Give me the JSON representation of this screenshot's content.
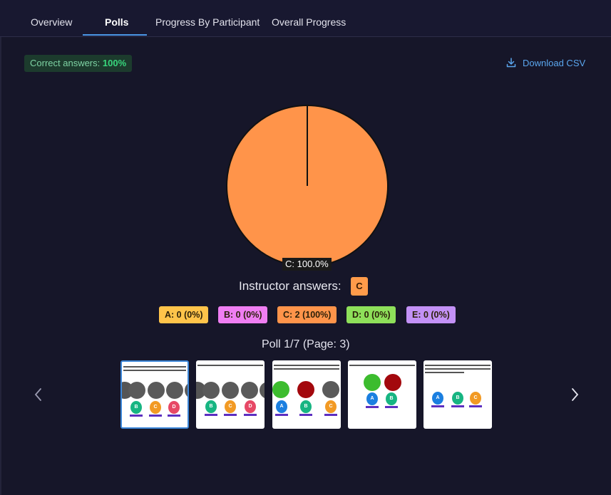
{
  "tabs": [
    {
      "label": "Overview",
      "active": false
    },
    {
      "label": "Polls",
      "active": true
    },
    {
      "label": "Progress By Participant",
      "active": false
    },
    {
      "label": "Overall Progress",
      "active": false
    }
  ],
  "correct_answers": {
    "label": "Correct answers:",
    "value": "100%"
  },
  "download": {
    "label": "Download CSV",
    "icon": "download-icon"
  },
  "chart_data": {
    "type": "pie",
    "slices": [
      {
        "label": "C",
        "value": 100.0,
        "color": "#ff944a"
      }
    ],
    "slice_label": "C: 100.0%"
  },
  "instructor": {
    "label": "Instructor answers:",
    "answer": "C"
  },
  "answers": [
    {
      "text": "A: 0 (0%)",
      "color": "#ffc44a"
    },
    {
      "text": "B: 0 (0%)",
      "color": "#ef7ef2"
    },
    {
      "text": "C: 2 (100%)",
      "color": "#ff944a"
    },
    {
      "text": "D: 0 (0%)",
      "color": "#8ee05a"
    },
    {
      "text": "E: 0 (0%)",
      "color": "#c391f6"
    }
  ],
  "poll": {
    "label": "Poll 1/7 (Page: 3)"
  },
  "thumb_buttons": {
    "a": "A",
    "b": "B",
    "c": "C",
    "d": "D"
  },
  "colors": {
    "accent": "#4b97e6",
    "background": "#161629",
    "correct": "#38d67c"
  }
}
